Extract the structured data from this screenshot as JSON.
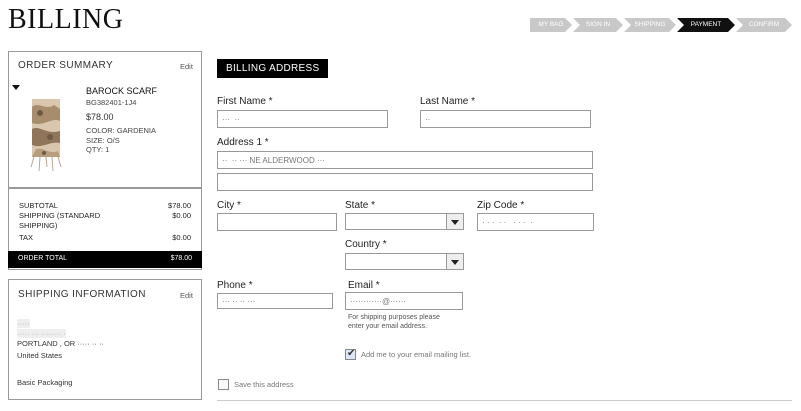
{
  "page": {
    "title": "BILLING"
  },
  "steps": [
    {
      "label": "MY BAG",
      "state": "done"
    },
    {
      "label": "SIGN IN",
      "state": "done"
    },
    {
      "label": "SHIPPING",
      "state": "done"
    },
    {
      "label": "PAYMENT",
      "state": "active"
    },
    {
      "label": "CONFIRM",
      "state": "todo"
    }
  ],
  "summary": {
    "title": "ORDER SUMMARY",
    "edit": "Edit",
    "product": {
      "name": "BAROCK SCARF",
      "sku": "BG382401-1J4",
      "price": "$78.00",
      "color": "COLOR: GARDENIA",
      "size": "SIZE: O/S",
      "qty": "QTY: 1"
    },
    "subtotal_label": "SUBTOTAL",
    "subtotal_value": "$78.00",
    "shipping_label": "SHIPPING (STANDARD",
    "shipping_label2": "SHIPPING)",
    "shipping_value": "$0.00",
    "tax_label": "TAX",
    "tax_value": "$0.00",
    "total_label": "ORDER TOTAL",
    "total_value": "$78.00"
  },
  "shipping_info": {
    "title": "SHIPPING INFORMATION",
    "edit": "Edit",
    "line1": "·····",
    "line2": "····· ··· ········ ·",
    "line3": "PORTLAND , OR  ·····  ·· ··",
    "country": "United States",
    "packaging": "Basic Packaging"
  },
  "billing": {
    "section_title": "BILLING ADDRESS",
    "first_name": {
      "label": "First Name *",
      "value": "···  ··"
    },
    "last_name": {
      "label": "Last Name *",
      "value": "··"
    },
    "address1": {
      "label": "Address 1 *",
      "value": "··  ·· ··· NE ALDERWOOD ···"
    },
    "address2": {
      "value": ""
    },
    "city": {
      "label": "City *",
      "value": ""
    },
    "state": {
      "label": "State *",
      "value": ""
    },
    "zip": {
      "label": "Zip Code *",
      "value": "· · ·  · ·   · · ·  ·"
    },
    "country": {
      "label": "Country *",
      "value": ""
    },
    "phone": {
      "label": "Phone *",
      "value": "··· ·· ·· ···"
    },
    "email": {
      "label": "Email *",
      "value": "············@······"
    },
    "email_hint1": "For shipping purposes please",
    "email_hint2": "enter your email address.",
    "mailing_list": "Add me to your email mailing list.",
    "save_address": "Save this address"
  },
  "colors": {
    "accent": "#000000",
    "step_inactive": "#c8c8c8"
  }
}
